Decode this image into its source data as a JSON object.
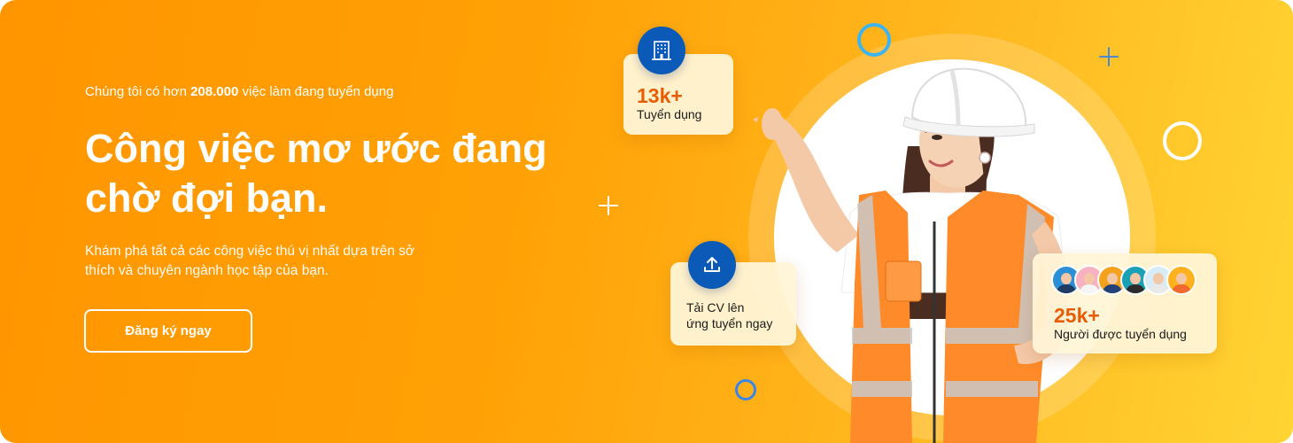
{
  "hero": {
    "kicker_prefix": "Chúng tôi có hơn",
    "kicker_count": "208.000",
    "kicker_suffix": "việc làm đang tuyển dụng",
    "headline_line1": "Công việc mơ ước đang",
    "headline_line2": "chờ đợi bạn.",
    "description_line1": "Khám phá tất cả các công việc thú vị nhất dựa trên sở",
    "description_line2": "thích và chuyên ngành học tập của bạn.",
    "cta_label": "Đăng ký ngay"
  },
  "stats": {
    "jobs": {
      "value": "13k+",
      "label": "Tuyển dụng",
      "icon": "building-icon"
    },
    "upload": {
      "label_line1": "Tải CV lên",
      "label_line2": "ứng tuyển ngay",
      "icon": "upload-icon"
    },
    "people": {
      "value": "25k+",
      "label": "Người được tuyển dụng",
      "icon": "avatars-group"
    }
  },
  "colors": {
    "gradient_start": "#ff9500",
    "gradient_end": "#ffd433",
    "stat_number": "#e85d04",
    "badge_blue": "#0b5ab7",
    "card_bg": "#fff4d6"
  },
  "avatars": [
    {
      "bg": "#2d8fd5",
      "shirt": "#1f3b63"
    },
    {
      "bg": "#f7b1c0",
      "shirt": "#f5f5f5"
    },
    {
      "bg": "#f4a21b",
      "shirt": "#23427a"
    },
    {
      "bg": "#1aa1b5",
      "shirt": "#2c2c2c"
    },
    {
      "bg": "#d7ecf7",
      "shirt": "#e9e9e9"
    },
    {
      "bg": "#ffb21e",
      "shirt": "#f06a2e"
    }
  ]
}
